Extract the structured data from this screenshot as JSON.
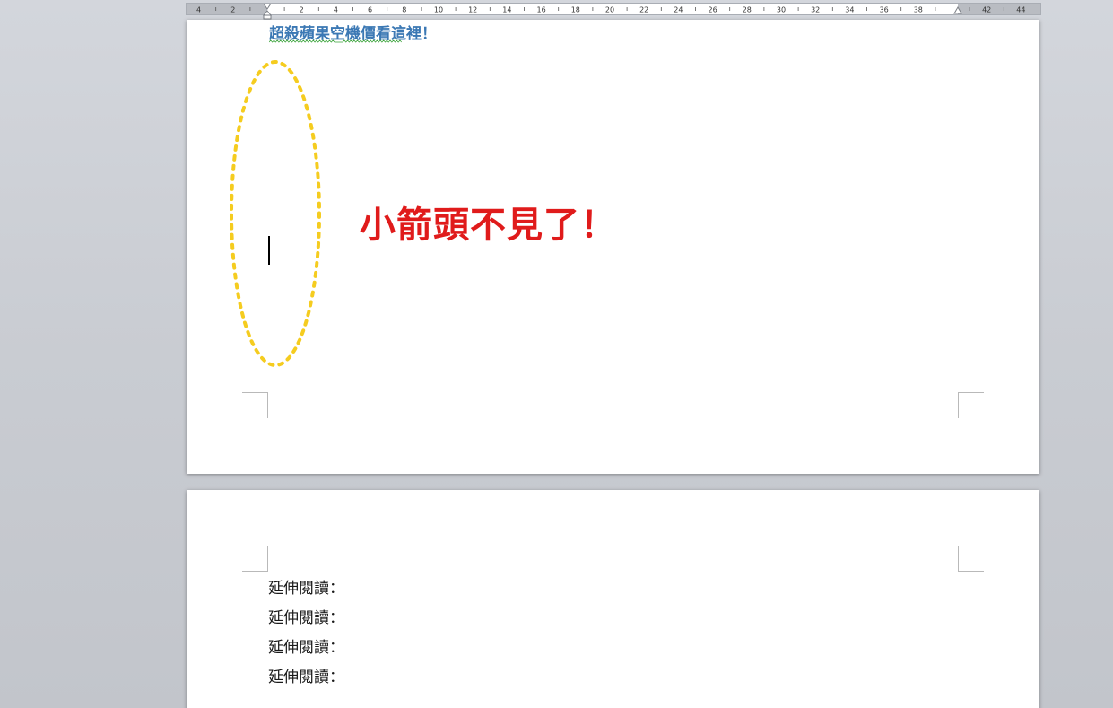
{
  "ruler": {
    "labels": [
      "4",
      "2",
      "2",
      "4",
      "6",
      "8",
      "10",
      "12",
      "14",
      "16",
      "18",
      "20",
      "22",
      "24",
      "26",
      "28",
      "30",
      "32",
      "34",
      "36",
      "38",
      "42",
      "44"
    ]
  },
  "page1": {
    "link_text": "超殺蘋果空機價看這裡！",
    "annotation": "小箭頭不見了！"
  },
  "page2": {
    "reading_items": [
      "延伸閱讀：",
      "延伸閱讀：",
      "延伸閱讀：",
      "延伸閱讀："
    ]
  },
  "colors": {
    "link": "#3b78b4",
    "annotation": "#e01b1b",
    "ellipse": "#f5cc1f"
  }
}
